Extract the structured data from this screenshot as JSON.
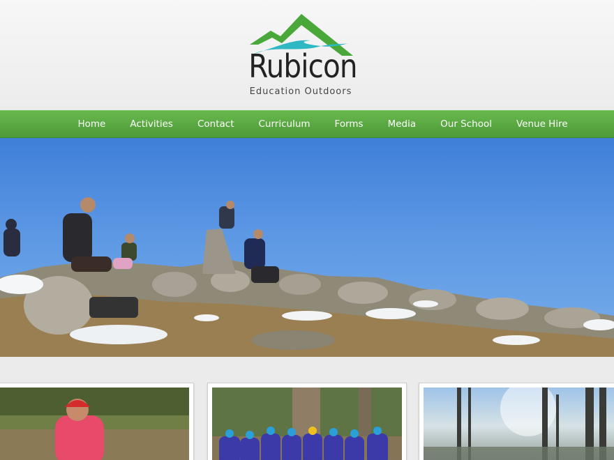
{
  "brand": {
    "title": "Rubicon",
    "subtitle": "Education Outdoors"
  },
  "nav": {
    "items": [
      "Home",
      "Activities",
      "Contact",
      "Curriculum",
      "Forms",
      "Media",
      "Our School",
      "Venue Hire"
    ]
  },
  "colors": {
    "nav_green": "#5aaa42",
    "logo_green": "#4aa83a",
    "logo_teal": "#2fb8c4",
    "sky_blue": "#5d98e4"
  },
  "hero": {
    "image": "hikers-on-rocky-snowy-summit-photo"
  },
  "cards": [
    {
      "image": "student-in-red-helmet-photo"
    },
    {
      "image": "group-in-rafting-gear-photo"
    },
    {
      "image": "misty-forest-sunlight-photo"
    }
  ]
}
